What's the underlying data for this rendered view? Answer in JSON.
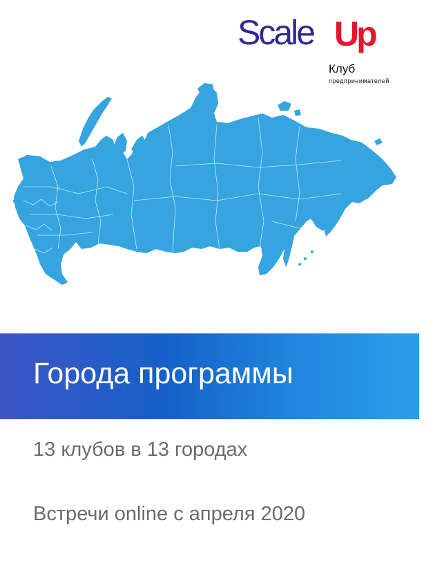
{
  "logo": {
    "word": "Scale",
    "up": "Up",
    "club": "Клуб",
    "subtitle": "предпринимателей",
    "colors": {
      "word": "#2f2a8e",
      "up": "#e3172f"
    }
  },
  "map": {
    "icon": "russia-map-icon",
    "fill": "#35a4df"
  },
  "banner": {
    "title": "Города программы"
  },
  "info": {
    "clubs": "13 клубов в 13 городах",
    "online": "Встречи online с апреля 2020"
  }
}
